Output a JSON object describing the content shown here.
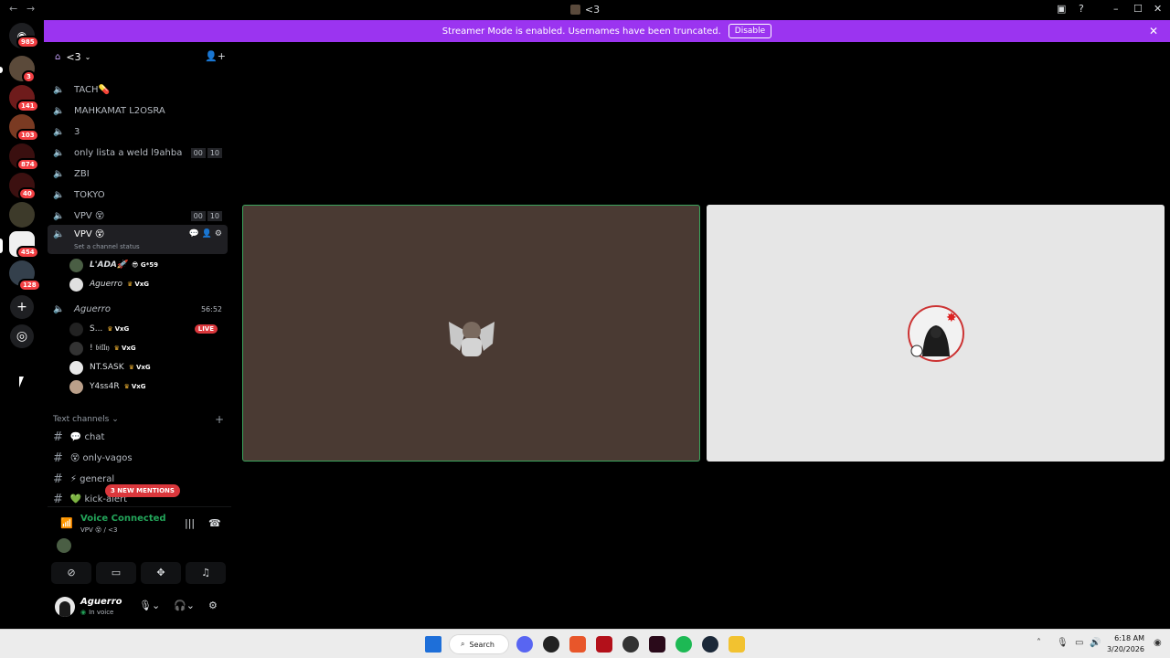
{
  "window": {
    "title": "<3",
    "back_icon": "←",
    "forward_icon": "→"
  },
  "banner": {
    "text": "Streamer Mode is enabled. Usernames have been truncated.",
    "button": "Disable"
  },
  "rail_badges": [
    "985",
    "3",
    "141",
    "103",
    "874",
    "454",
    "40",
    "128"
  ],
  "guild": {
    "name": "<3"
  },
  "voice_channels": [
    {
      "name": "TACH💊"
    },
    {
      "name": "MAHKAMAT L2OSRA"
    },
    {
      "name": "3"
    },
    {
      "name": "only lista a weld l9ahba",
      "c1": "00",
      "c2": "10"
    },
    {
      "name": "ZBI"
    },
    {
      "name": "TOKYO"
    },
    {
      "name": "VPV 😵",
      "c1": "00",
      "c2": "10"
    },
    {
      "name": "VPV 😵",
      "status": "Set a channel status"
    }
  ],
  "vpv_members": [
    {
      "name": "L'ADA🚀",
      "tag": "😎 G*59"
    },
    {
      "name": "Aguerro",
      "tag": "VxG"
    }
  ],
  "aguerro_channel": {
    "name": "Aguerro",
    "timer": "56:52"
  },
  "aguerro_members": [
    {
      "name": "S...",
      "tag": "VxG",
      "live": "LIVE"
    },
    {
      "name": "! 𝔟𝔦𝔩𝔩𝔶",
      "tag": "VxG"
    },
    {
      "name": "NT.SASK",
      "tag": "VxG"
    },
    {
      "name": "Y4ss4R",
      "tag": "VxG"
    }
  ],
  "text_section": {
    "label": "Text channels"
  },
  "text_channels": [
    {
      "name": "💬 chat"
    },
    {
      "name": "😵 only-vagos"
    },
    {
      "name": "⚡ general"
    },
    {
      "name": "💚 kick-alert"
    }
  ],
  "mentions": "3 NEW MENTIONS",
  "voice_status": {
    "title": "Voice Connected",
    "sub": "VPV 😵 / <3"
  },
  "me": {
    "name": "Aguerro",
    "status": "In voice"
  },
  "taskbar": {
    "search": "Search",
    "time": "6:18 AM",
    "date": "3/20/2026"
  }
}
